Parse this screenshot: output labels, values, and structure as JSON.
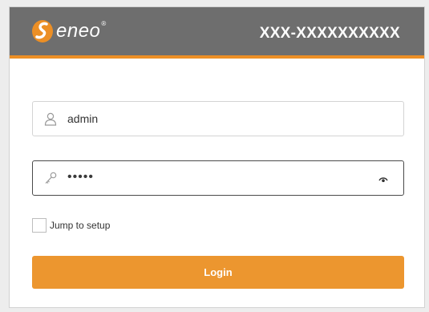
{
  "header": {
    "logo_text": "eneo",
    "logo_mark": "®",
    "device_name": "XXX-XXXXXXXXXX"
  },
  "form": {
    "username": {
      "value": "admin",
      "icon": "user-icon"
    },
    "password": {
      "value": "•••••",
      "icon": "key-icon",
      "toggle_icon": "eye-icon"
    },
    "jump_to_setup": {
      "label": "Jump to setup",
      "checked": false
    },
    "login_label": "Login"
  },
  "colors": {
    "header_bg": "#6e6e6e",
    "accent": "#ec962f"
  }
}
